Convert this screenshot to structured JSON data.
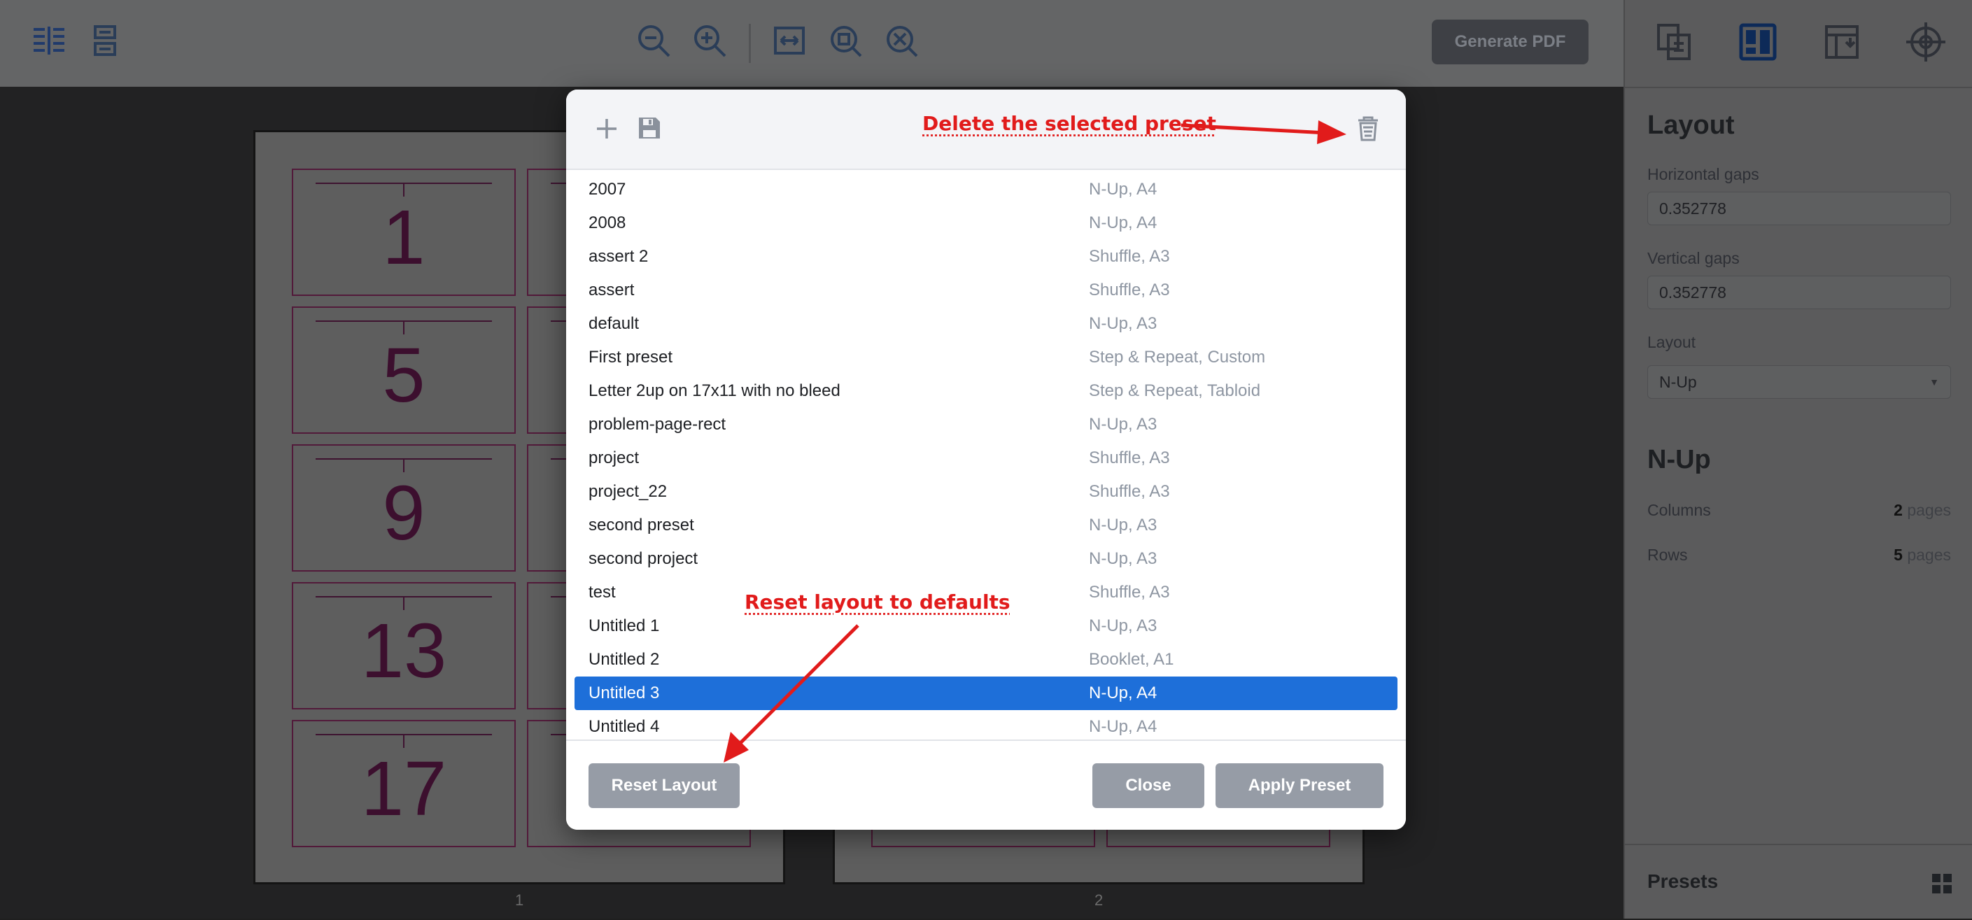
{
  "toolbar": {
    "generate_pdf_label": "Generate PDF",
    "icons": [
      "two-column-view-icon",
      "single-column-view-icon",
      "zoom-out-icon",
      "zoom-in-icon",
      "fit-width-icon",
      "fit-page-icon",
      "zoom-reset-icon"
    ]
  },
  "canvas": {
    "pages": [
      {
        "label": "1",
        "numbers": [
          "1",
          "5",
          "9",
          "13",
          "17"
        ]
      },
      {
        "label": "2"
      }
    ],
    "mark_color": "#3c0f2e"
  },
  "right_panel": {
    "tabs": [
      "pages-tab",
      "layout-tab",
      "marks-tab",
      "registration-tab"
    ],
    "active_tab": "layout-tab",
    "layout_title": "Layout",
    "horizontal_gaps_label": "Horizontal gaps",
    "horizontal_gaps_value": "0.352778",
    "vertical_gaps_label": "Vertical gaps",
    "vertical_gaps_value": "0.352778",
    "layout_label": "Layout",
    "layout_value": "N-Up",
    "nup_title": "N-Up",
    "columns_label": "Columns",
    "columns_value": "2",
    "columns_unit": "pages",
    "rows_label": "Rows",
    "rows_value": "5",
    "rows_unit": "pages",
    "presets_title": "Presets"
  },
  "modal": {
    "presets": [
      {
        "name": "2007",
        "meta": "N-Up, A4"
      },
      {
        "name": "2008",
        "meta": "N-Up, A4"
      },
      {
        "name": "assert 2",
        "meta": "Shuffle, A3"
      },
      {
        "name": "assert",
        "meta": "Shuffle, A3"
      },
      {
        "name": "default",
        "meta": "N-Up, A3"
      },
      {
        "name": "First preset",
        "meta": "Step & Repeat, Custom"
      },
      {
        "name": "Letter 2up on 17x11 with no bleed",
        "meta": "Step & Repeat, Tabloid"
      },
      {
        "name": "problem-page-rect",
        "meta": "N-Up, A3"
      },
      {
        "name": "project",
        "meta": "Shuffle, A3"
      },
      {
        "name": "project_22",
        "meta": "Shuffle, A3"
      },
      {
        "name": "second preset",
        "meta": "N-Up, A3"
      },
      {
        "name": "second project",
        "meta": "N-Up, A3"
      },
      {
        "name": "test",
        "meta": "Shuffle, A3"
      },
      {
        "name": "Untitled 1",
        "meta": "N-Up, A3"
      },
      {
        "name": "Untitled 2",
        "meta": "Booklet, A1"
      },
      {
        "name": "Untitled 3",
        "meta": "N-Up, A4",
        "selected": true
      },
      {
        "name": "Untitled 4",
        "meta": "N-Up, A4"
      }
    ],
    "reset_label": "Reset Layout",
    "close_label": "Close",
    "apply_label": "Apply Preset",
    "selection_color": "#1e6fd9"
  },
  "annotations": {
    "delete_note": "Delete the selected preset",
    "reset_note": "Reset layout to defaults",
    "color": "#e11b1b"
  }
}
